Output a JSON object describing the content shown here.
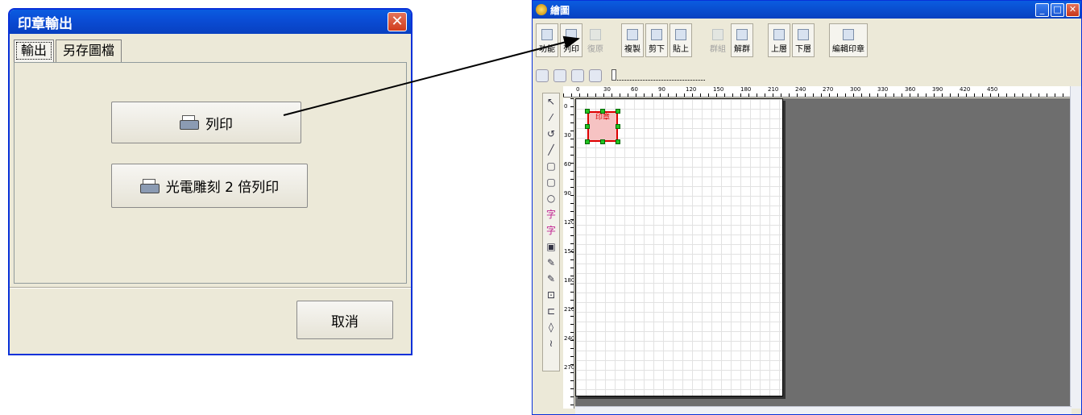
{
  "dialog": {
    "title": "印章輸出",
    "close_glyph": "✕",
    "tabs": [
      {
        "label": "輸出"
      },
      {
        "label": "另存圖檔"
      }
    ],
    "print_button": "列印",
    "laser_print_button": "光電雕刻 2 倍列印",
    "cancel_button": "取消"
  },
  "window": {
    "title": "繪圖",
    "controls": {
      "minimize": "_",
      "maximize": "□",
      "close": "✕"
    },
    "toolbar": [
      {
        "label": "功能",
        "enabled": true
      },
      {
        "label": "列印",
        "enabled": true
      },
      {
        "label": "復原",
        "enabled": false
      },
      {
        "label": "複製",
        "enabled": true
      },
      {
        "label": "剪下",
        "enabled": true
      },
      {
        "label": "貼上",
        "enabled": true
      },
      {
        "label": "群組",
        "enabled": false
      },
      {
        "label": "解群",
        "enabled": true
      },
      {
        "label": "上層",
        "enabled": true
      },
      {
        "label": "下層",
        "enabled": true
      },
      {
        "label": "編輯印章",
        "enabled": true
      }
    ],
    "ruler_top_ticks": [
      "0",
      "30",
      "60",
      "90",
      "120",
      "150",
      "180",
      "210",
      "240",
      "270",
      "300",
      "330",
      "360",
      "390",
      "420",
      "450"
    ],
    "ruler_left_ticks": [
      "0",
      "30",
      "60",
      "90",
      "120",
      "150",
      "180",
      "210",
      "240",
      "270"
    ],
    "tool_glyphs": [
      "↖",
      "⁄",
      "↺",
      "╱",
      "▢",
      "▢",
      "○",
      "字",
      "字",
      "▣",
      "✎",
      "✎",
      "⊡",
      "⊏",
      "◊",
      "≀"
    ],
    "stamp_text": "印章"
  }
}
